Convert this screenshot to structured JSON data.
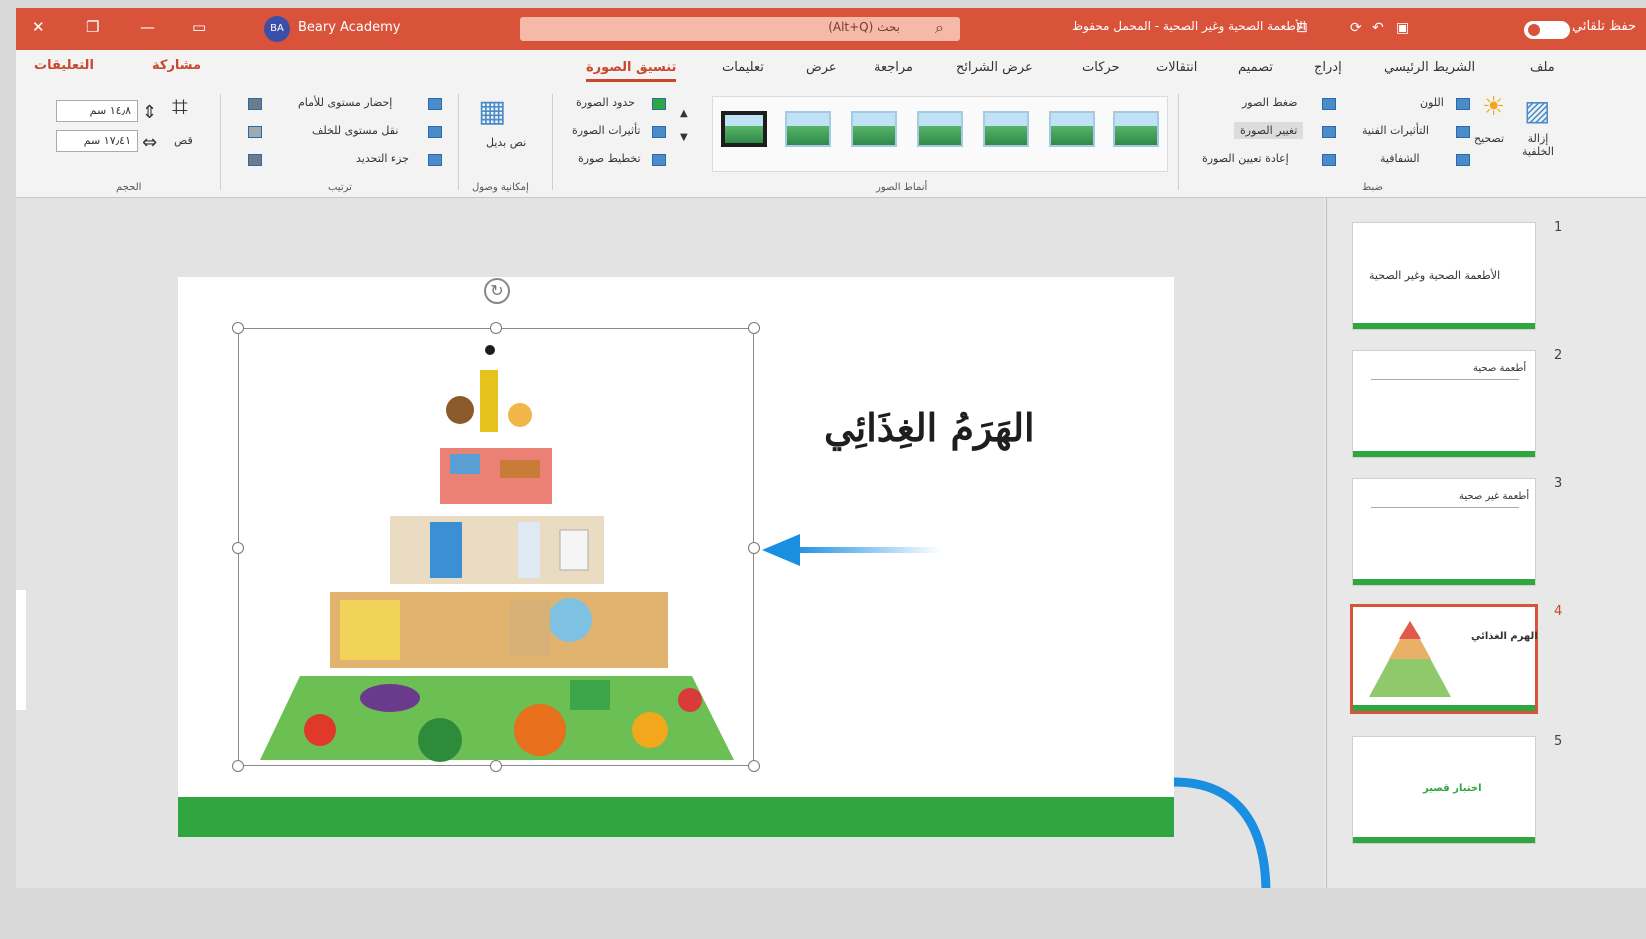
{
  "titlebar": {
    "user": "Beary Academy",
    "avatar": "BA",
    "search_placeholder": "بحث (Alt+Q)",
    "doc_title": "الأطعمة الصحية وغير الصحية - المحمل محفوظ",
    "autosave": "حفظ تلقائي"
  },
  "tabs": [
    "ملف",
    "الشريط الرئيسي",
    "إدراج",
    "تصميم",
    "انتقالات",
    "حركات",
    "عرض الشرائح",
    "مراجعة",
    "عرض",
    "تعليمات",
    "تنسيق الصورة"
  ],
  "share": "مشاركة",
  "comments": "التعليقات",
  "ribbon": {
    "remove_bg": "إزالة الخلفية",
    "corrections": "تصحيح",
    "color": "اللون",
    "artistic": "التأثيرات الفنية",
    "transparency": "الشفافية",
    "compress": "ضغط الصور",
    "change_pic": "تغيير الصورة",
    "reset_pic": "إعادة تعيين الصورة",
    "adjust_group": "ضبط",
    "border": "حدود الصورة",
    "effects": "تأثيرات الصورة",
    "layout": "تخطيط صورة",
    "styles_group": "أنماط الصور",
    "alt_text": "نص بديل",
    "access_group": "إمكانية وصول",
    "bring_forward": "إحضار مستوى للأمام",
    "send_backward": "نقل مستوى للخلف",
    "selection_pane": "جزء التحديد",
    "arrange_group": "ترتيب",
    "crop": "قص",
    "height": "١٤٫٨ سم",
    "width": "١٧٫٤١ سم",
    "size_group": "الحجم"
  },
  "slide": {
    "title": "الهَرَمُ الغِذَائِي"
  },
  "thumbnails": [
    {
      "num": "1",
      "text": "الأطعمة الصحية وغير الصحية"
    },
    {
      "num": "2",
      "text": "أطعمة صحية"
    },
    {
      "num": "3",
      "text": "أطعمة غير صحية"
    },
    {
      "num": "4",
      "text": "الهرم الغذائي"
    },
    {
      "num": "5",
      "text": "اختبار قصير"
    }
  ],
  "colors": {
    "accent": "#d9533a",
    "slide_bar": "#2fa63f",
    "arrow": "#1a8ee0"
  }
}
